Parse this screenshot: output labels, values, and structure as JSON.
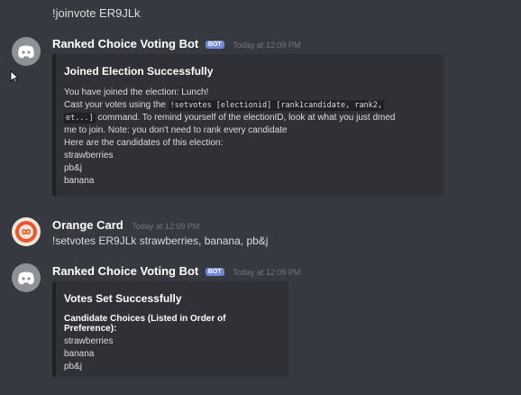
{
  "top_message": "!joinvote ER9JLk",
  "messages": [
    {
      "author": "Ranked Choice Voting Bot",
      "badge": "BOT",
      "timestamp": "Today at 12:09 PM",
      "embed": {
        "title": "Joined Election Successfully",
        "line1": "You have joined the election: Lunch!",
        "line2_pre": "Cast your votes using the",
        "line2_code": "!setvotes [electionid] [rank1candidate, rank2,",
        "line3_code": "et...]",
        "line3_post": "command. To remind yourself of the electionID, look at what you just dmed",
        "line4": "me to join. Note: you don't need to rank every candidate",
        "line5": "Here are the candidates of this election:",
        "candidates": [
          "strawberries",
          "pb&j",
          "banana"
        ]
      }
    },
    {
      "author": "Orange Card",
      "timestamp": "Today at 12:09 PM",
      "content": "!setvotes ER9JLk strawberries, banana, pb&j"
    },
    {
      "author": "Ranked Choice Voting Bot",
      "badge": "BOT",
      "timestamp": "Today at 12:09 PM",
      "embed": {
        "title": "Votes Set Successfully",
        "field_name": "Candidate Choices (Listed in Order of Preference):",
        "choices": [
          "strawberries",
          "banana",
          "pb&j"
        ]
      }
    }
  ]
}
